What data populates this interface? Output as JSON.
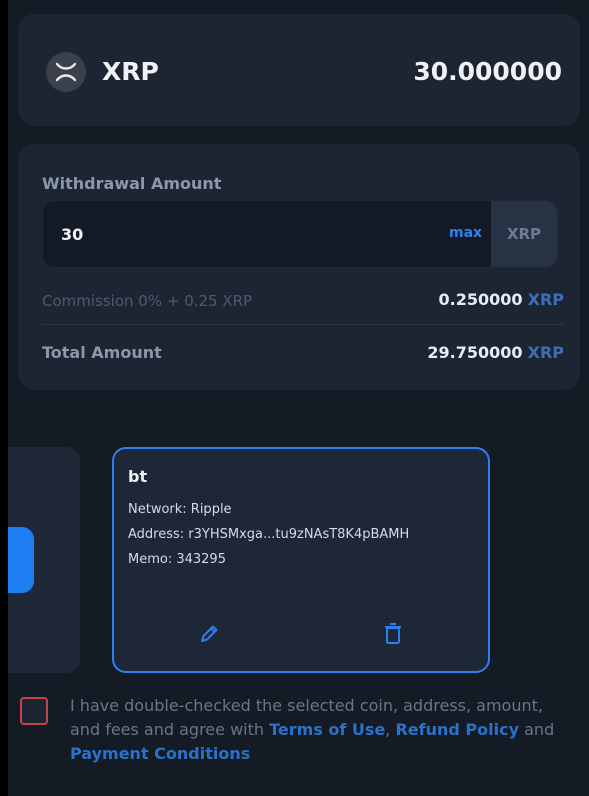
{
  "coin": {
    "symbol": "XRP",
    "balance": "30.000000",
    "icon": "xrp-logo-icon"
  },
  "withdrawal": {
    "label": "Withdrawal Amount",
    "amount_value": "30",
    "max_label": "max",
    "currency": "XRP",
    "commission_label": "Commission 0% + 0.25 XRP",
    "commission_value": "0.250000",
    "commission_unit": "XRP",
    "total_label": "Total Amount",
    "total_value": "29.750000",
    "total_unit": "XRP"
  },
  "address_book": {
    "selected": {
      "name": "bt",
      "network": "Network: Ripple",
      "address": "Address: r3YHSMxga...tu9zNAsT8K4pBAMH",
      "memo": "Memo: 343295",
      "edit_icon": "pencil-icon",
      "delete_icon": "trash-icon"
    }
  },
  "agreement": {
    "text_before": "I have double-checked the selected coin, address, amount, and fees and agree with ",
    "terms_link": "Terms of Use",
    "comma": ",",
    "refund_link": "Refund Policy",
    "and_text": " and ",
    "payment_link": "Payment Conditions"
  },
  "colors": {
    "background": "#141b25",
    "card": "#1d2533",
    "accent": "#2f80ed",
    "checkbox_border": "#c2434a"
  }
}
